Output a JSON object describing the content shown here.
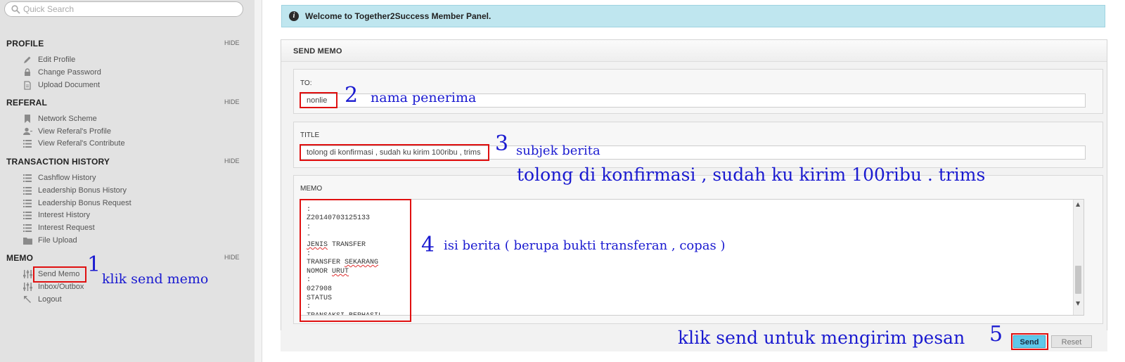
{
  "search": {
    "placeholder": "Quick Search"
  },
  "sidebar": {
    "hide_label": "HIDE",
    "sections": [
      {
        "title": "PROFILE",
        "items": [
          {
            "label": "Edit Profile",
            "icon": "pencil-icon"
          },
          {
            "label": "Change Password",
            "icon": "lock-icon"
          },
          {
            "label": "Upload Document",
            "icon": "document-icon"
          }
        ]
      },
      {
        "title": "REFERAL",
        "items": [
          {
            "label": "Network Scheme",
            "icon": "bookmark-icon"
          },
          {
            "label": "View Referal's Profile",
            "icon": "user-icon"
          },
          {
            "label": "View Referal's Contribute",
            "icon": "list-icon"
          }
        ]
      },
      {
        "title": "TRANSACTION HISTORY",
        "items": [
          {
            "label": "Cashflow History",
            "icon": "list-icon"
          },
          {
            "label": "Leadership Bonus History",
            "icon": "list-icon"
          },
          {
            "label": "Leadership Bonus Request",
            "icon": "list-icon"
          },
          {
            "label": "Interest History",
            "icon": "list-icon"
          },
          {
            "label": "Interest Request",
            "icon": "list-icon"
          },
          {
            "label": "File Upload",
            "icon": "folder-icon"
          }
        ]
      },
      {
        "title": "MEMO",
        "items": [
          {
            "label": "Send Memo",
            "icon": "sliders-icon"
          },
          {
            "label": "Inbox/Outbox",
            "icon": "sliders-icon"
          },
          {
            "label": "Logout",
            "icon": "logout-arrow-icon"
          }
        ]
      }
    ]
  },
  "alert": {
    "text": "Welcome to Together2Success Member Panel."
  },
  "panel": {
    "title": "SEND MEMO"
  },
  "form": {
    "to_label": "TO:",
    "to_value": "nonlie",
    "title_label": "TITLE",
    "title_value": "tolong di konfirmasi , sudah ku kirim 100ribu , trims",
    "memo_label": "MEMO",
    "memo_lines": [
      ":",
      "Z20140703125133",
      ":",
      "-",
      "JENIS TRANSFER",
      ":",
      "TRANSFER SEKARANG",
      "NOMOR URUT",
      ":",
      "027908",
      "STATUS",
      ":",
      "TRANSAKSI BERHASIL"
    ],
    "send_label": "Send",
    "reset_label": "Reset"
  },
  "annotations": {
    "n1": "1",
    "t1": "klik send memo",
    "n2": "2",
    "t2": "nama penerima",
    "n3": "3",
    "t3": "subjek berita",
    "t3b": "tolong di konfirmasi , sudah ku kirim 100ribu . trims",
    "n4": "4",
    "t4": "isi berita ( berupa bukti transferan , copas )",
    "n5": "5",
    "t5": "klik send untuk mengirim pesan"
  },
  "colors": {
    "alert_bg": "#bfe6ef",
    "send_button": "#5ec8ea",
    "annotation_blue": "#1a1ad0",
    "highlight_red": "#e01010"
  }
}
